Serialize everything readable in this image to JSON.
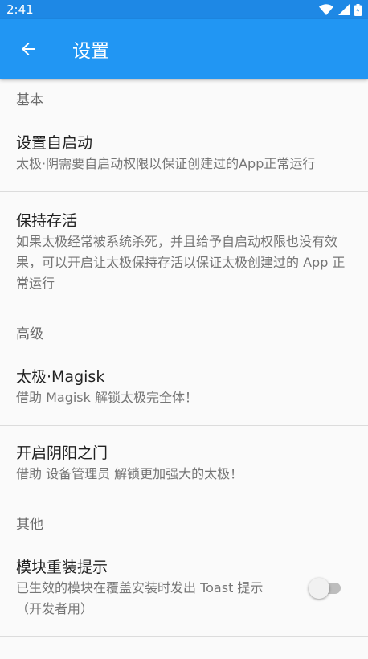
{
  "status": {
    "time": "2:41"
  },
  "appbar": {
    "title": "设置"
  },
  "sections": {
    "basic": {
      "header": "基本",
      "autostart": {
        "title": "设置自启动",
        "summary": "太极·阴需要自启动权限以保证创建过的App正常运行"
      },
      "keepalive": {
        "title": "保持存活",
        "summary": "如果太极经常被系统杀死，并且给予自启动权限也没有效果，可以开启让太极保持存活以保证太极创建过的 App 正常运行"
      }
    },
    "advanced": {
      "header": "高级",
      "magisk": {
        "title": "太极·Magisk",
        "summary": "借助 Magisk 解锁太极完全体！"
      },
      "yinyang": {
        "title": "开启阴阳之门",
        "summary": "借助 设备管理员 解锁更加强大的太极！"
      }
    },
    "other": {
      "header": "其他",
      "reinstall": {
        "title": "模块重装提示",
        "summary": "已生效的模块在覆盖安装时发出 Toast 提示（开发者用）",
        "enabled": false
      }
    }
  },
  "colors": {
    "primary": "#2196f3",
    "statusbar": "#1e88e5"
  }
}
